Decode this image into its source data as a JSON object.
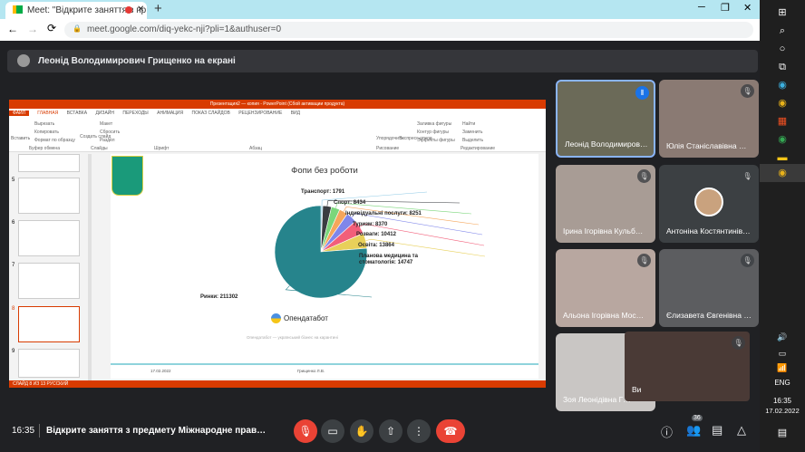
{
  "browser": {
    "tab_title": "Meet: \"Відкрите заняття з пр",
    "new_tab": "+",
    "url": "meet.google.com/diq-yekc-nji?pli=1&authuser=0"
  },
  "banner": {
    "text": "Леонід Володимирович Грищенко на екрані"
  },
  "ppt": {
    "title": "Презентация2 — копия - PowerPoint (Сбой активации продукта)",
    "menu": [
      "ФАЙЛ",
      "ГЛАВНАЯ",
      "ВСТАВКА",
      "ДИЗАЙН",
      "ПЕРЕХОДЫ",
      "АНИМАЦИЯ",
      "ПОКАЗ СЛАЙДОВ",
      "РЕЦЕНЗИРОВАНИЕ",
      "ВИД"
    ],
    "ribbon_groups": [
      "Буфер обмена",
      "Слайды",
      "Шрифт",
      "Абзац",
      "Рисование",
      "Редактирование"
    ],
    "ribbon_items": [
      "Вырезать",
      "Копировать",
      "Формат по образцу",
      "Вставить",
      "Создать слайд",
      "Макет",
      "Сбросить",
      "Раздел",
      "Упорядочить",
      "Экспресс-стили",
      "Заливка фигуры",
      "Контур фигуры",
      "Эффекты фигуры",
      "Найти",
      "Заменить",
      "Выделить"
    ],
    "slide_numbers": [
      "5",
      "6",
      "7",
      "8",
      "9"
    ],
    "status": "СЛАЙД 8 ИЗ 13     РУССКИЙ",
    "footer_date": "17.02.2022",
    "footer_author": "Грищенко Л.В.",
    "logo_text": "Опендатабот",
    "source_text": "Опендатабот — український бізнес на карантині"
  },
  "chart_data": {
    "type": "pie",
    "title": "Фопи без роботи",
    "slices": [
      {
        "label": "Транспорт",
        "value": 1791,
        "color": "#8ecae6"
      },
      {
        "label": "Спорт",
        "value": 8434,
        "color": "#3a3d42"
      },
      {
        "label": "Індивідуальні послуги",
        "value": 8251,
        "color": "#7bd67b"
      },
      {
        "label": "Туризм",
        "value": 8370,
        "color": "#f5a65b"
      },
      {
        "label": "Розваги",
        "value": 10412,
        "color": "#7f86ea"
      },
      {
        "label": "Освіта",
        "value": 13864,
        "color": "#f25f7a"
      },
      {
        "label": "Планова медицина та стоматологія",
        "value": 14747,
        "color": "#e8d05a"
      },
      {
        "label": "Ринки",
        "value": 211302,
        "color": "#26848c"
      }
    ]
  },
  "labels": [
    "Транспорт: 1791",
    "Спорт: 8434",
    "Індивідуальні послуги: 8251",
    "Туризм: 8370",
    "Розваги: 10412",
    "Освіта: 13864",
    "Планова медицина та",
    "стоматологія: 14747",
    "Ринки: 211302"
  ],
  "participants": [
    {
      "name": "Леонід Володимирович Грищенко",
      "bg": "#6b6a58"
    },
    {
      "name": "Юлія Станіславівна …",
      "bg": "#8a7a73"
    },
    {
      "name": "Ірина Ігорівна Кульб…",
      "bg": "#a89c95"
    },
    {
      "name": "Антоніна Костянтинівна …",
      "bg": "#3c4043"
    },
    {
      "name": "Альона Ігорівна Мос…",
      "bg": "#b8a7a0"
    },
    {
      "name": "Єлизавета Євгенівна …",
      "bg": "#5c5d60"
    },
    {
      "name": "Зоя Леонідівна Г…",
      "bg": "#c9c6c4"
    }
  ],
  "self_view": {
    "label": "Ви"
  },
  "bottom": {
    "time": "16:35",
    "meeting": "Відкрите заняття з предмету Міжнародне прав…",
    "people_count": "36"
  },
  "taskbar": {
    "lang": "ENG",
    "time": "16:35",
    "date": "17.02.2022"
  }
}
